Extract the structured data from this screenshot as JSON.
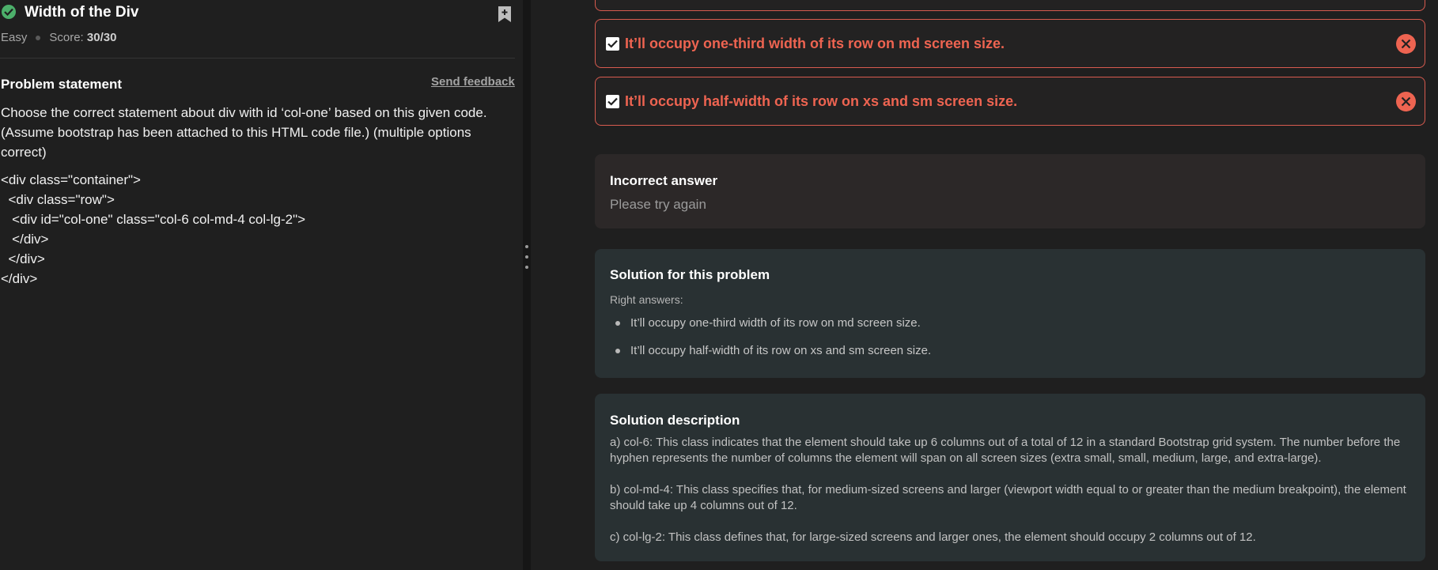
{
  "problem": {
    "title": "Width of the Div",
    "difficulty": "Easy",
    "score_label": "Score:",
    "score_value": "30/30",
    "statement_label": "Problem statement",
    "feedback_link": "Send feedback",
    "statement": "Choose the correct statement about div with id ‘col-one’ based on this given code. (Assume bootstrap has been attached to this HTML code file.) (multiple options correct)",
    "code_lines": [
      "<div class=\"container\">",
      "  <div class=\"row\">",
      "   <div id=\"col-one\" class=\"col-6 col-md-4 col-lg-2\">",
      "   </div>",
      "  </div>",
      "</div>"
    ]
  },
  "options": [
    {
      "text": "It’ll occupy one-third width of its row on md screen size.",
      "checked": true,
      "status": "wrong"
    },
    {
      "text": "It’ll occupy half-width of its row on xs and sm screen size.",
      "checked": true,
      "status": "wrong"
    }
  ],
  "result": {
    "title": "Incorrect answer",
    "message": "Please try again"
  },
  "solution": {
    "title": "Solution for this problem",
    "right_answers_label": "Right answers:",
    "answers": [
      "It’ll occupy one-third width of its row on md screen size.",
      "It’ll occupy half-width of its row on xs and sm screen size."
    ]
  },
  "description": {
    "title": "Solution description",
    "paragraphs": [
      "a) col-6: This class indicates that the element should take up 6 columns out of a total of 12 in a standard Bootstrap grid system. The number before the hyphen represents the number of columns the element will span on all screen sizes (extra small, small, medium, large, and extra-large).",
      "b) col-md-4: This class specifies that, for medium-sized screens and larger (viewport width equal to or greater than the medium breakpoint), the element should take up 4 columns out of 12.",
      "c) col-lg-2: This class defines that, for large-sized screens and larger ones, the element should occupy 2 columns out of 12."
    ]
  },
  "colors": {
    "background": "#1f1f1f",
    "error": "#ee6451",
    "success": "#4caf6a",
    "solution_card": "#293133",
    "incorrect_card": "#2c2828"
  }
}
